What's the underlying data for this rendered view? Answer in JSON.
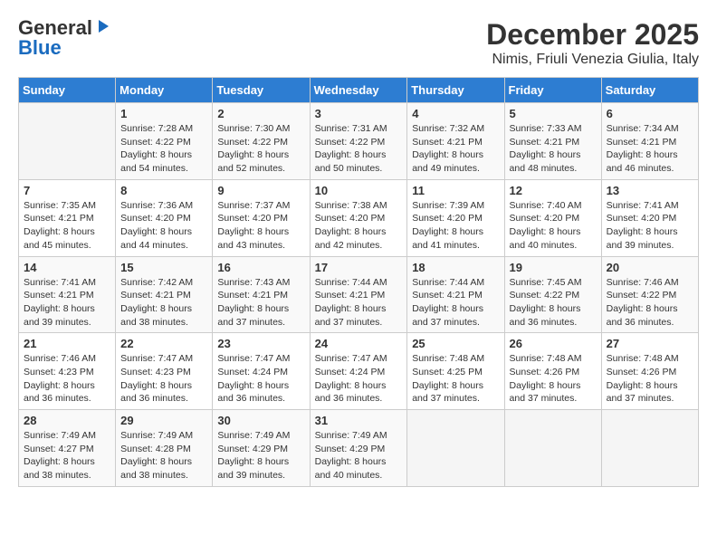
{
  "logo": {
    "general": "General",
    "blue": "Blue"
  },
  "title": "December 2025",
  "subtitle": "Nimis, Friuli Venezia Giulia, Italy",
  "days_of_week": [
    "Sunday",
    "Monday",
    "Tuesday",
    "Wednesday",
    "Thursday",
    "Friday",
    "Saturday"
  ],
  "weeks": [
    [
      {
        "day": "",
        "info": ""
      },
      {
        "day": "1",
        "info": "Sunrise: 7:28 AM\nSunset: 4:22 PM\nDaylight: 8 hours\nand 54 minutes."
      },
      {
        "day": "2",
        "info": "Sunrise: 7:30 AM\nSunset: 4:22 PM\nDaylight: 8 hours\nand 52 minutes."
      },
      {
        "day": "3",
        "info": "Sunrise: 7:31 AM\nSunset: 4:22 PM\nDaylight: 8 hours\nand 50 minutes."
      },
      {
        "day": "4",
        "info": "Sunrise: 7:32 AM\nSunset: 4:21 PM\nDaylight: 8 hours\nand 49 minutes."
      },
      {
        "day": "5",
        "info": "Sunrise: 7:33 AM\nSunset: 4:21 PM\nDaylight: 8 hours\nand 48 minutes."
      },
      {
        "day": "6",
        "info": "Sunrise: 7:34 AM\nSunset: 4:21 PM\nDaylight: 8 hours\nand 46 minutes."
      }
    ],
    [
      {
        "day": "7",
        "info": "Sunrise: 7:35 AM\nSunset: 4:21 PM\nDaylight: 8 hours\nand 45 minutes."
      },
      {
        "day": "8",
        "info": "Sunrise: 7:36 AM\nSunset: 4:20 PM\nDaylight: 8 hours\nand 44 minutes."
      },
      {
        "day": "9",
        "info": "Sunrise: 7:37 AM\nSunset: 4:20 PM\nDaylight: 8 hours\nand 43 minutes."
      },
      {
        "day": "10",
        "info": "Sunrise: 7:38 AM\nSunset: 4:20 PM\nDaylight: 8 hours\nand 42 minutes."
      },
      {
        "day": "11",
        "info": "Sunrise: 7:39 AM\nSunset: 4:20 PM\nDaylight: 8 hours\nand 41 minutes."
      },
      {
        "day": "12",
        "info": "Sunrise: 7:40 AM\nSunset: 4:20 PM\nDaylight: 8 hours\nand 40 minutes."
      },
      {
        "day": "13",
        "info": "Sunrise: 7:41 AM\nSunset: 4:20 PM\nDaylight: 8 hours\nand 39 minutes."
      }
    ],
    [
      {
        "day": "14",
        "info": "Sunrise: 7:41 AM\nSunset: 4:21 PM\nDaylight: 8 hours\nand 39 minutes."
      },
      {
        "day": "15",
        "info": "Sunrise: 7:42 AM\nSunset: 4:21 PM\nDaylight: 8 hours\nand 38 minutes."
      },
      {
        "day": "16",
        "info": "Sunrise: 7:43 AM\nSunset: 4:21 PM\nDaylight: 8 hours\nand 37 minutes."
      },
      {
        "day": "17",
        "info": "Sunrise: 7:44 AM\nSunset: 4:21 PM\nDaylight: 8 hours\nand 37 minutes."
      },
      {
        "day": "18",
        "info": "Sunrise: 7:44 AM\nSunset: 4:21 PM\nDaylight: 8 hours\nand 37 minutes."
      },
      {
        "day": "19",
        "info": "Sunrise: 7:45 AM\nSunset: 4:22 PM\nDaylight: 8 hours\nand 36 minutes."
      },
      {
        "day": "20",
        "info": "Sunrise: 7:46 AM\nSunset: 4:22 PM\nDaylight: 8 hours\nand 36 minutes."
      }
    ],
    [
      {
        "day": "21",
        "info": "Sunrise: 7:46 AM\nSunset: 4:23 PM\nDaylight: 8 hours\nand 36 minutes."
      },
      {
        "day": "22",
        "info": "Sunrise: 7:47 AM\nSunset: 4:23 PM\nDaylight: 8 hours\nand 36 minutes."
      },
      {
        "day": "23",
        "info": "Sunrise: 7:47 AM\nSunset: 4:24 PM\nDaylight: 8 hours\nand 36 minutes."
      },
      {
        "day": "24",
        "info": "Sunrise: 7:47 AM\nSunset: 4:24 PM\nDaylight: 8 hours\nand 36 minutes."
      },
      {
        "day": "25",
        "info": "Sunrise: 7:48 AM\nSunset: 4:25 PM\nDaylight: 8 hours\nand 37 minutes."
      },
      {
        "day": "26",
        "info": "Sunrise: 7:48 AM\nSunset: 4:26 PM\nDaylight: 8 hours\nand 37 minutes."
      },
      {
        "day": "27",
        "info": "Sunrise: 7:48 AM\nSunset: 4:26 PM\nDaylight: 8 hours\nand 37 minutes."
      }
    ],
    [
      {
        "day": "28",
        "info": "Sunrise: 7:49 AM\nSunset: 4:27 PM\nDaylight: 8 hours\nand 38 minutes."
      },
      {
        "day": "29",
        "info": "Sunrise: 7:49 AM\nSunset: 4:28 PM\nDaylight: 8 hours\nand 38 minutes."
      },
      {
        "day": "30",
        "info": "Sunrise: 7:49 AM\nSunset: 4:29 PM\nDaylight: 8 hours\nand 39 minutes."
      },
      {
        "day": "31",
        "info": "Sunrise: 7:49 AM\nSunset: 4:29 PM\nDaylight: 8 hours\nand 40 minutes."
      },
      {
        "day": "",
        "info": ""
      },
      {
        "day": "",
        "info": ""
      },
      {
        "day": "",
        "info": ""
      }
    ]
  ]
}
